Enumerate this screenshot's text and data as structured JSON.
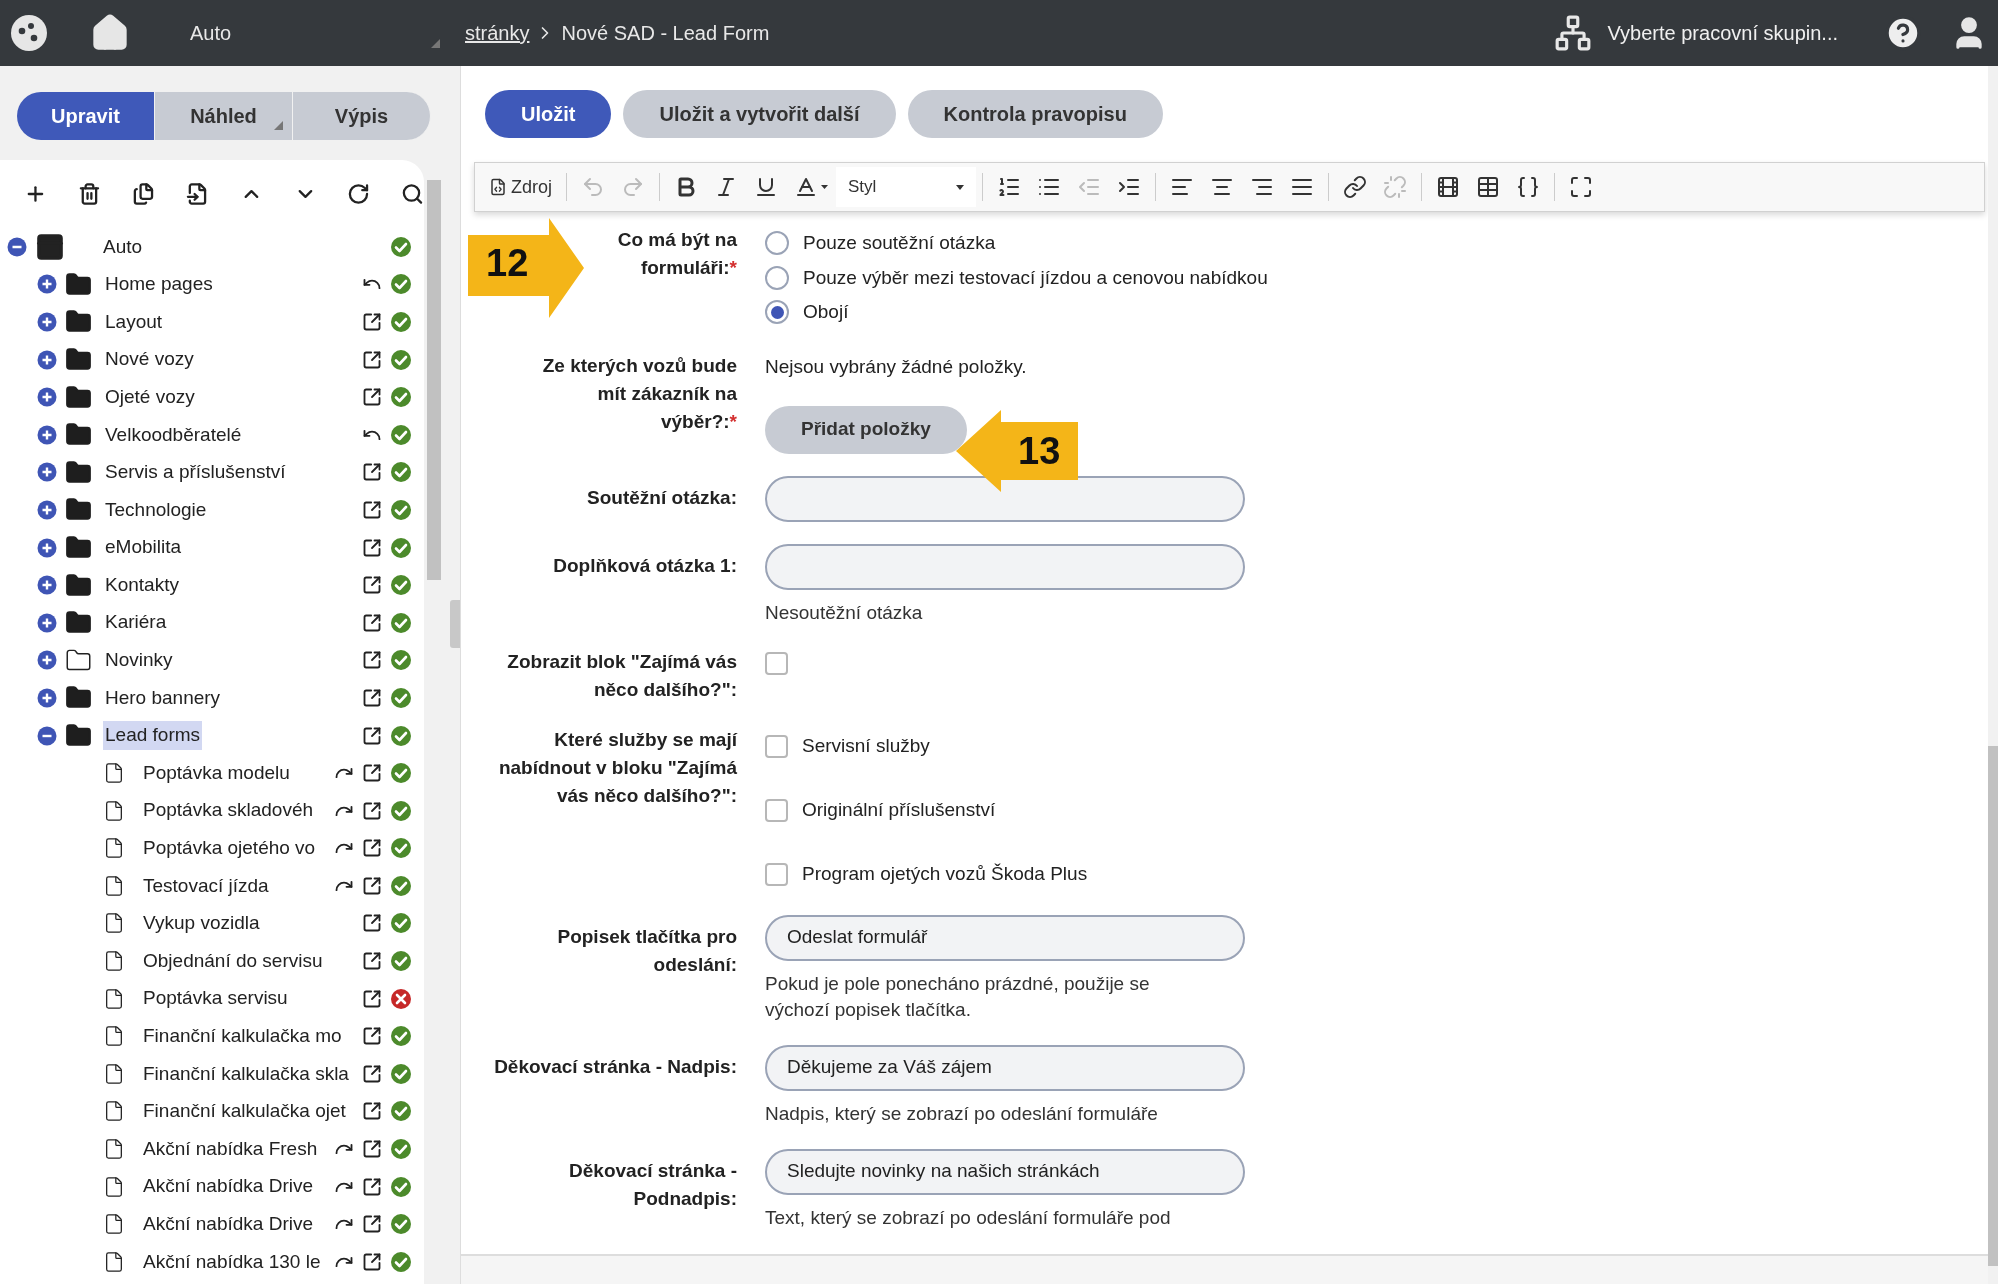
{
  "topbar": {
    "site": "Auto",
    "breadcrumb": [
      {
        "label": "stránky",
        "link": true
      },
      {
        "label": "Nové SAD - Lead Form",
        "link": false
      }
    ],
    "workgroup": "Vyberte pracovní skupin..."
  },
  "sidebar": {
    "tabs": [
      {
        "label": "Upravit",
        "selected": true,
        "dropdown": false
      },
      {
        "label": "Náhled",
        "selected": false,
        "dropdown": true
      },
      {
        "label": "Výpis",
        "selected": false,
        "dropdown": false
      }
    ],
    "tools": [
      {
        "kind": "add"
      },
      {
        "kind": "delete"
      },
      {
        "kind": "copy"
      },
      {
        "kind": "move"
      },
      {
        "kind": "up"
      },
      {
        "kind": "down"
      },
      {
        "kind": "refresh"
      },
      {
        "kind": "search"
      }
    ],
    "tree": [
      {
        "label": "Auto",
        "kind": "layout",
        "expanded": true,
        "selected": false,
        "ok": true,
        "children": [
          {
            "label": "Home pages",
            "kind": "folder",
            "expanded": false,
            "selected": false,
            "actions": [
              {
                "kind": "undo"
              }
            ],
            "ok": true
          },
          {
            "label": "Layout",
            "kind": "folder",
            "expanded": false,
            "selected": false,
            "actions": [
              {
                "kind": "external"
              }
            ],
            "ok": true
          },
          {
            "label": "Nové vozy",
            "kind": "folder",
            "expanded": false,
            "selected": false,
            "actions": [
              {
                "kind": "external"
              }
            ],
            "ok": true
          },
          {
            "label": "Ojeté vozy",
            "kind": "folder",
            "expanded": false,
            "selected": false,
            "actions": [
              {
                "kind": "external"
              }
            ],
            "ok": true
          },
          {
            "label": "Velkoodběratelé",
            "kind": "folder",
            "expanded": false,
            "selected": false,
            "actions": [
              {
                "kind": "undo"
              }
            ],
            "ok": true
          },
          {
            "label": "Servis a příslušenství",
            "kind": "folder",
            "expanded": false,
            "selected": false,
            "actions": [
              {
                "kind": "external"
              }
            ],
            "ok": true
          },
          {
            "label": "Technologie",
            "kind": "folder",
            "expanded": false,
            "selected": false,
            "actions": [
              {
                "kind": "external"
              }
            ],
            "ok": true
          },
          {
            "label": "eMobilita",
            "kind": "folder",
            "expanded": false,
            "selected": false,
            "actions": [
              {
                "kind": "external"
              }
            ],
            "ok": true
          },
          {
            "label": "Kontakty",
            "kind": "folder",
            "expanded": false,
            "selected": false,
            "actions": [
              {
                "kind": "external"
              }
            ],
            "ok": true
          },
          {
            "label": "Kariéra",
            "kind": "folder",
            "expanded": false,
            "selected": false,
            "actions": [
              {
                "kind": "external"
              }
            ],
            "ok": true
          },
          {
            "label": "Novinky",
            "kind": "empty-folder",
            "expanded": false,
            "selected": false,
            "actions": [
              {
                "kind": "external"
              }
            ],
            "ok": true
          },
          {
            "label": "Hero bannery",
            "kind": "folder",
            "expanded": false,
            "selected": false,
            "actions": [
              {
                "kind": "external"
              }
            ],
            "ok": true
          },
          {
            "label": "Lead forms",
            "kind": "folder",
            "expanded": true,
            "selected": true,
            "actions": [
              {
                "kind": "external"
              }
            ],
            "ok": true,
            "children": [
              {
                "label": "Poptávka modelu",
                "kind": "page",
                "selected": false,
                "actions": [
                  {
                    "kind": "redirect"
                  },
                  {
                    "kind": "external"
                  }
                ],
                "ok": true
              },
              {
                "label": "Poptávka skladovéh",
                "kind": "page",
                "selected": false,
                "actions": [
                  {
                    "kind": "redirect"
                  },
                  {
                    "kind": "external"
                  }
                ],
                "ok": true
              },
              {
                "label": "Poptávka ojetého vo",
                "kind": "page",
                "selected": false,
                "actions": [
                  {
                    "kind": "redirect"
                  },
                  {
                    "kind": "external"
                  }
                ],
                "ok": true
              },
              {
                "label": "Testovací jízda",
                "kind": "page",
                "selected": false,
                "actions": [
                  {
                    "kind": "redirect"
                  },
                  {
                    "kind": "external"
                  }
                ],
                "ok": true
              },
              {
                "label": "Vykup vozidla",
                "kind": "page",
                "selected": false,
                "actions": [
                  {
                    "kind": "external"
                  }
                ],
                "ok": true
              },
              {
                "label": "Objednání do servisu",
                "kind": "page",
                "selected": false,
                "actions": [
                  {
                    "kind": "external"
                  }
                ],
                "ok": true
              },
              {
                "label": "Poptávka servisu",
                "kind": "page",
                "selected": false,
                "actions": [
                  {
                    "kind": "external"
                  }
                ],
                "ok": false
              },
              {
                "label": "Finanční kalkulačka mo",
                "kind": "page",
                "selected": false,
                "actions": [
                  {
                    "kind": "external"
                  }
                ],
                "ok": true
              },
              {
                "label": "Finanční kalkulačka skla",
                "kind": "page",
                "selected": false,
                "actions": [
                  {
                    "kind": "external"
                  }
                ],
                "ok": true
              },
              {
                "label": "Finanční kalkulačka ojet",
                "kind": "page",
                "selected": false,
                "actions": [
                  {
                    "kind": "external"
                  }
                ],
                "ok": true
              },
              {
                "label": "Akční nabídka Fresh",
                "kind": "page",
                "selected": false,
                "actions": [
                  {
                    "kind": "redirect"
                  },
                  {
                    "kind": "external"
                  }
                ],
                "ok": true
              },
              {
                "label": "Akční nabídka Drive",
                "kind": "page",
                "selected": false,
                "actions": [
                  {
                    "kind": "redirect"
                  },
                  {
                    "kind": "external"
                  }
                ],
                "ok": true
              },
              {
                "label": "Akční nabídka Drive",
                "kind": "page",
                "selected": false,
                "actions": [
                  {
                    "kind": "redirect"
                  },
                  {
                    "kind": "external"
                  }
                ],
                "ok": true
              },
              {
                "label": "Akční nabídka 130 le",
                "kind": "page",
                "selected": false,
                "actions": [
                  {
                    "kind": "redirect"
                  },
                  {
                    "kind": "external"
                  }
                ],
                "ok": true
              }
            ]
          }
        ]
      }
    ]
  },
  "actions": [
    {
      "label": "Uložit",
      "primary": true
    },
    {
      "label": "Uložit a vytvořit další",
      "primary": false
    },
    {
      "label": "Kontrola pravopisu",
      "primary": false
    }
  ],
  "editor_toolbar": [
    [
      {
        "kind": "source",
        "label": "Zdroj",
        "disabled": false
      }
    ],
    [
      {
        "kind": "undo",
        "disabled": true
      },
      {
        "kind": "redo",
        "disabled": true
      }
    ],
    [
      {
        "kind": "bold",
        "disabled": false
      },
      {
        "kind": "italic",
        "disabled": false
      },
      {
        "kind": "underline",
        "disabled": false
      },
      {
        "kind": "text-color",
        "disabled": false
      },
      {
        "kind": "style",
        "label": "Styl",
        "disabled": false
      }
    ],
    [
      {
        "kind": "numbered-list",
        "disabled": false
      },
      {
        "kind": "bulleted-list",
        "disabled": false
      },
      {
        "kind": "outdent",
        "disabled": true
      },
      {
        "kind": "indent",
        "disabled": false
      }
    ],
    [
      {
        "kind": "align-left",
        "disabled": false
      },
      {
        "kind": "align-center",
        "disabled": false
      },
      {
        "kind": "align-right",
        "disabled": false
      },
      {
        "kind": "justify",
        "disabled": false
      }
    ],
    [
      {
        "kind": "link",
        "disabled": false
      },
      {
        "kind": "unlink",
        "disabled": true
      }
    ],
    [
      {
        "kind": "media",
        "disabled": false
      },
      {
        "kind": "table",
        "disabled": false
      },
      {
        "kind": "placeholder",
        "disabled": false
      }
    ],
    [
      {
        "kind": "maximize",
        "disabled": false
      }
    ]
  ],
  "callouts": [
    {
      "number": "12",
      "kind": "arrow-right"
    },
    {
      "number": "13",
      "kind": "arrow-left"
    }
  ],
  "form": [
    {
      "kind": "radio",
      "label": "Co má být na\nformuláři:",
      "required": "*",
      "options": [
        {
          "label": "Pouze soutěžní otázka",
          "selected": false
        },
        {
          "label": "Pouze výběr mezi testovací jízdou a cenovou nabídkou",
          "selected": false
        },
        {
          "label": "Obojí",
          "selected": true
        }
      ]
    },
    {
      "kind": "picker",
      "label": "Ze kterých vozů bude\nmít zákazník na\nvýběr?:",
      "required": "*",
      "note": "Nejsou vybrány žádné položky.",
      "button": "Přidat položky"
    },
    {
      "kind": "text",
      "label": "Soutěžní otázka:"
    },
    {
      "kind": "text",
      "label": "Doplňková otázka 1:",
      "help": "Nesoutěžní otázka"
    },
    {
      "kind": "checkbox",
      "label": "Zobrazit blok \"Zajímá vás\nněco dalšího?\":",
      "checked": false
    },
    {
      "kind": "checklist",
      "label": "Které služby se mají\nnabídnout v bloku \"Zajímá\nvás něco dalšího?\":",
      "options": [
        {
          "label": "Servisní služby",
          "checked": false
        },
        {
          "label": "Originální příslušenství",
          "checked": false
        },
        {
          "label": "Program ojetých vozů Škoda Plus",
          "checked": false
        }
      ]
    },
    {
      "kind": "text",
      "label": "Popisek tlačítka pro\nodeslání:",
      "value": "Odeslat formulář",
      "help": "Pokud je pole ponecháno prázdné, použije se\nvýchozí popisek tlačítka."
    },
    {
      "kind": "text",
      "label": "Děkovací stránka - Nadpis:",
      "value": "Děkujeme za Váš zájem",
      "help": "Nadpis, který se zobrazí po odeslání formuláře"
    },
    {
      "kind": "text",
      "label": "Děkovací stránka -\nPodnadpis:",
      "value": "Sledujte novinky na našich stránkách",
      "help": "Text, který se zobrazí po odeslání formuláře pod"
    }
  ]
}
